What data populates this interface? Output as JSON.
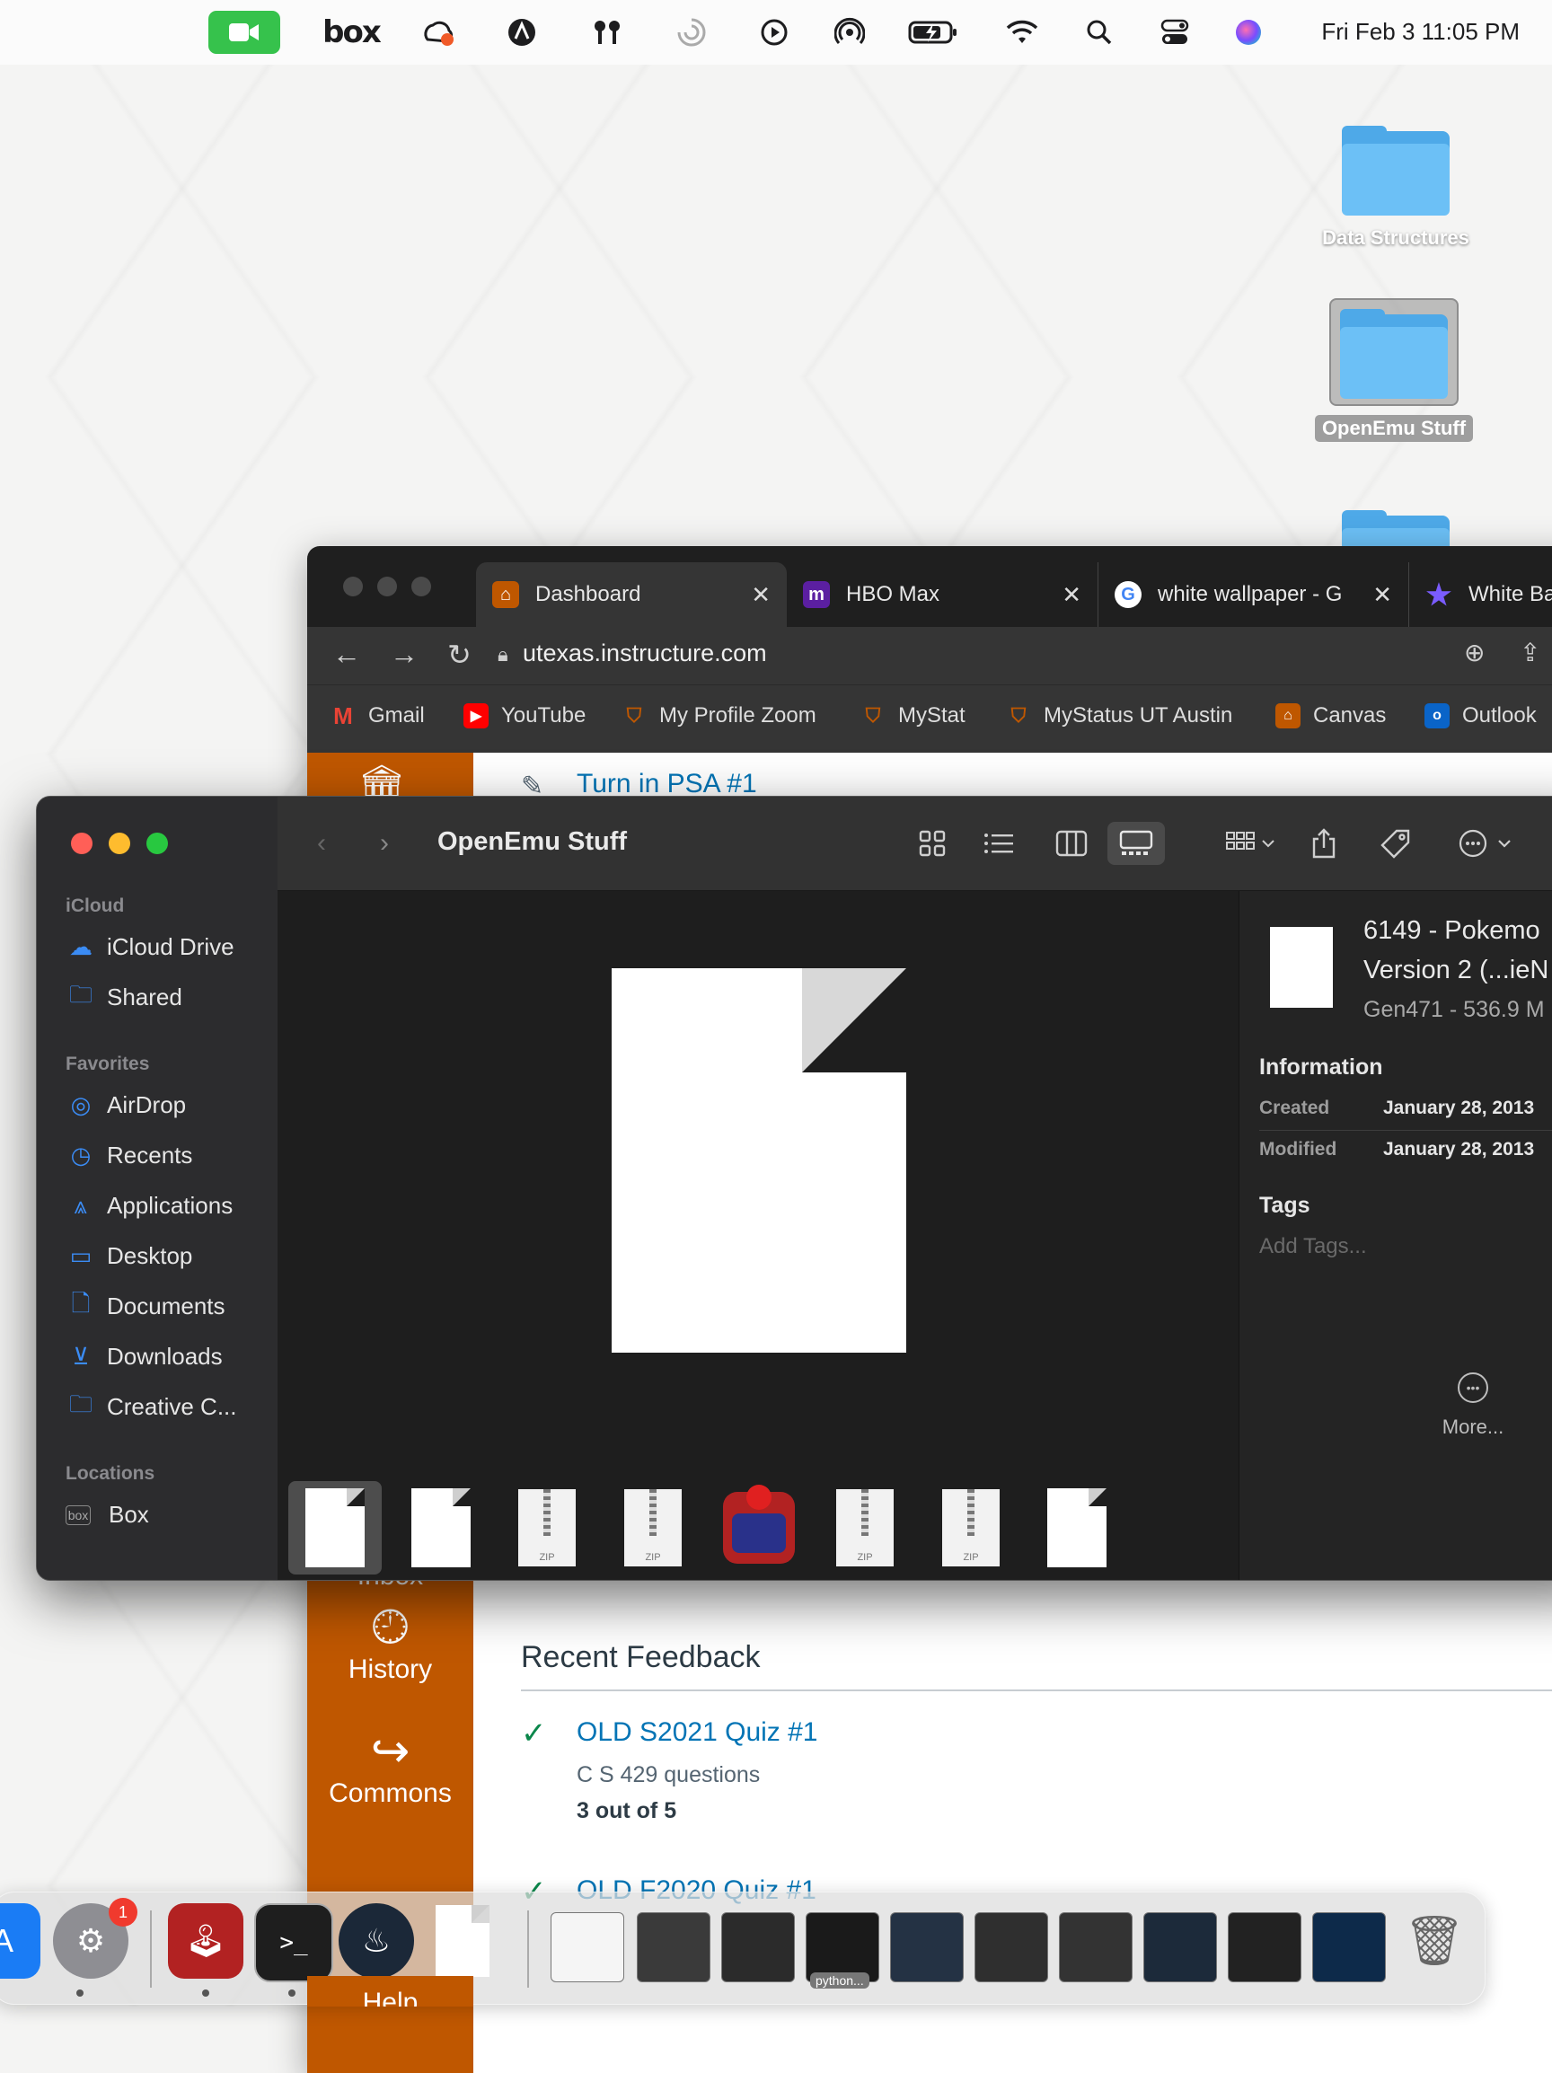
{
  "menubar": {
    "clock": "Fri Feb 3  11:05 PM",
    "box_label": "box",
    "icons": [
      "facetime-icon",
      "box-icon",
      "creative-cloud-icon",
      "vpn-icon",
      "airpods-icon",
      "focus-icon",
      "play-icon",
      "airplay-icon",
      "battery-icon",
      "wifi-icon",
      "search-icon",
      "control-center-icon",
      "siri-icon"
    ]
  },
  "desktop": {
    "items": [
      {
        "label": "Data Structures",
        "selected": false
      },
      {
        "label": "OpenEmu Stuff",
        "selected": true
      }
    ]
  },
  "chrome": {
    "tabs": [
      {
        "label": "Dashboard",
        "active": true,
        "favicon": "canvas-icon"
      },
      {
        "label": "HBO Max",
        "active": false,
        "favicon": "hbo-max-icon"
      },
      {
        "label": "white wallpaper - G",
        "active": false,
        "favicon": "google-icon"
      },
      {
        "label": "White Ba",
        "active": false,
        "favicon": "star-icon"
      }
    ],
    "url": "utexas.instructure.com",
    "bookmarks": [
      "Gmail",
      "YouTube",
      "My Profile Zoom",
      "MyStat",
      "MyStatus UT Austin",
      "Canvas",
      "Outlook"
    ],
    "canvas_nav": [
      {
        "label": "Inbox"
      },
      {
        "label": "History"
      },
      {
        "label": "Commons"
      },
      {
        "label": "Help"
      }
    ],
    "todo_item": "Turn in PSA #1",
    "recent_feedback": {
      "title": "Recent Feedback",
      "items": [
        {
          "title": "OLD S2021 Quiz #1",
          "course": "C S 429 questions",
          "score": "3 out of 5"
        },
        {
          "title": "OLD F2020 Quiz #1"
        }
      ]
    }
  },
  "finder": {
    "title": "OpenEmu Stuff",
    "sidebar": {
      "sections": [
        {
          "heading": "iCloud",
          "items": [
            {
              "label": "iCloud Drive",
              "icon": "cloud-icon"
            },
            {
              "label": "Shared",
              "icon": "shared-folder-icon"
            }
          ]
        },
        {
          "heading": "Favorites",
          "items": [
            {
              "label": "AirDrop",
              "icon": "airdrop-icon"
            },
            {
              "label": "Recents",
              "icon": "clock-icon"
            },
            {
              "label": "Applications",
              "icon": "applications-icon"
            },
            {
              "label": "Desktop",
              "icon": "desktop-icon"
            },
            {
              "label": "Documents",
              "icon": "document-icon"
            },
            {
              "label": "Downloads",
              "icon": "download-icon"
            },
            {
              "label": "Creative C...",
              "icon": "folder-icon"
            }
          ]
        },
        {
          "heading": "Locations",
          "items": [
            {
              "label": "Box",
              "icon": "box-drive-icon"
            }
          ]
        }
      ]
    },
    "preview": {
      "name_line1": "6149 - Pokemo",
      "name_line2": "Version 2 (...ieN",
      "subtitle": "Gen471 - 536.9 M",
      "info_heading": "Information",
      "created_label": "Created",
      "created_value": "January 28, 2013",
      "modified_label": "Modified",
      "modified_value": "January 28, 2013",
      "tags_heading": "Tags",
      "tags_placeholder": "Add Tags...",
      "more_label": "More..."
    },
    "thumbnails": [
      "document",
      "document",
      "zip",
      "zip",
      "openemu-app",
      "zip",
      "zip",
      "document"
    ],
    "zip_label": "ZIP"
  },
  "dock": {
    "settings_badge": "1",
    "python_label": "python..."
  }
}
